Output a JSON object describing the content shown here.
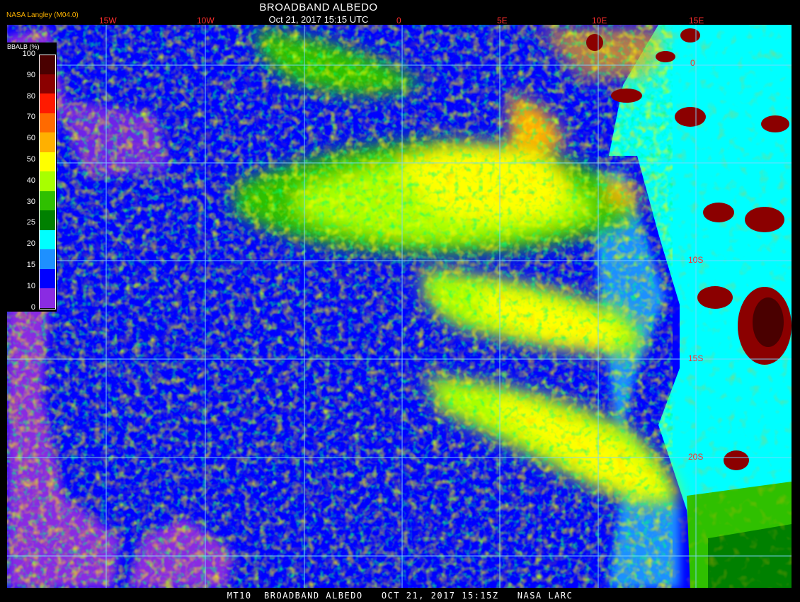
{
  "header": {
    "title": "BROADBAND ALBEDO",
    "datetime": "Oct 21, 2017 15:15 UTC",
    "provider": "NASA Langley (M04.0)"
  },
  "footer": {
    "caption": "MT10  BROADBAND ALBEDO   OCT 21, 2017 15:15Z   NASA LARC"
  },
  "legend": {
    "title": "BBALB (%)",
    "ticks": [
      "100",
      "90",
      "80",
      "70",
      "60",
      "50",
      "40",
      "30",
      "25",
      "20",
      "15",
      "10",
      "0"
    ],
    "colors": [
      "#4a0000",
      "#8b0000",
      "#ff1a00",
      "#ff6a00",
      "#ffb000",
      "#ffff00",
      "#a8ff00",
      "#2fc000",
      "#008000",
      "#00ffff",
      "#1e90ff",
      "#0000ff",
      "#8a2be2"
    ]
  },
  "grid": {
    "longitude_labels": [
      "15W",
      "10W",
      "0",
      "5E",
      "10E",
      "15E"
    ],
    "latitude_labels": [
      "0",
      "10S",
      "15S",
      "20S"
    ]
  }
}
